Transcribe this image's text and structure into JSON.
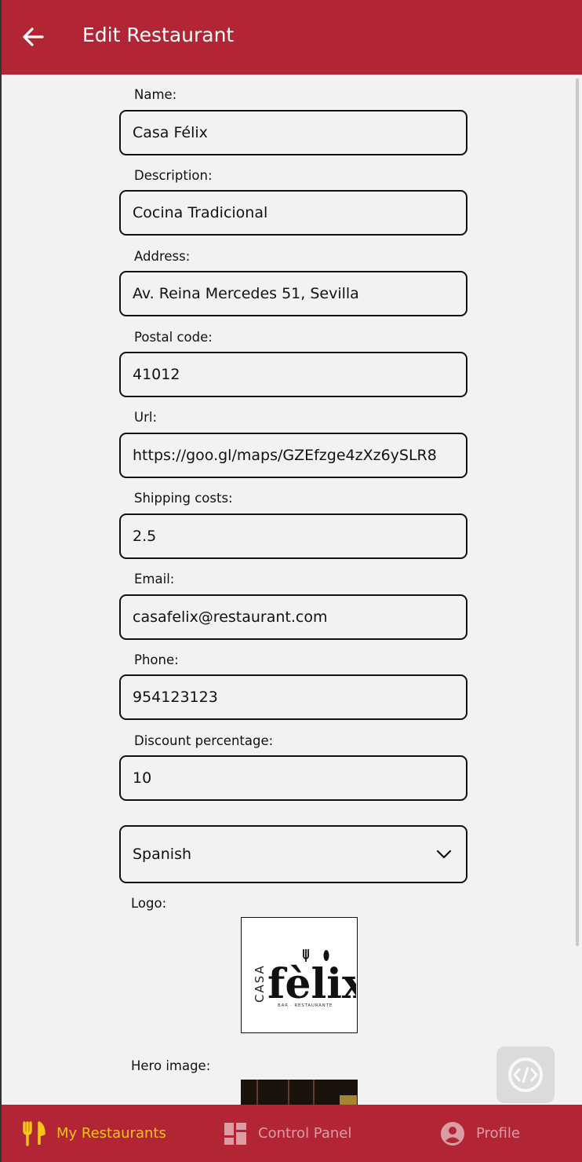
{
  "header": {
    "title": "Edit Restaurant",
    "back_icon": "arrow-left-icon"
  },
  "form": {
    "name": {
      "label": "Name:",
      "value": "Casa Félix"
    },
    "description": {
      "label": "Description:",
      "value": "Cocina Tradicional"
    },
    "address": {
      "label": "Address:",
      "value": "Av. Reina Mercedes 51, Sevilla"
    },
    "postal_code": {
      "label": "Postal code:",
      "value": "41012"
    },
    "url": {
      "label": "Url:",
      "value": "https://goo.gl/maps/GZEfzge4zXz6ySLR8"
    },
    "shipping_costs": {
      "label": "Shipping costs:",
      "value": "2.5"
    },
    "email": {
      "label": "Email:",
      "value": "casafelix@restaurant.com"
    },
    "phone": {
      "label": "Phone:",
      "value": "954123123"
    },
    "discount": {
      "label": "Discount percentage:",
      "value": "10"
    },
    "category": {
      "selected": "Spanish"
    },
    "logo": {
      "label": "Logo:",
      "text_vertical": "CASA",
      "text_main": "fèlix",
      "text_sub": "BAR · RESTAURANTE"
    },
    "hero": {
      "label": "Hero image:"
    }
  },
  "bottom_nav": {
    "items": [
      {
        "label": "My Restaurants",
        "icon": "utensils-icon",
        "active": true
      },
      {
        "label": "Control Panel",
        "icon": "dashboard-icon",
        "active": false
      },
      {
        "label": "Profile",
        "icon": "account-circle-icon",
        "active": false
      }
    ]
  },
  "colors": {
    "primary": "#b12534",
    "active_nav": "#f5c518",
    "background": "#f2f2f2"
  }
}
